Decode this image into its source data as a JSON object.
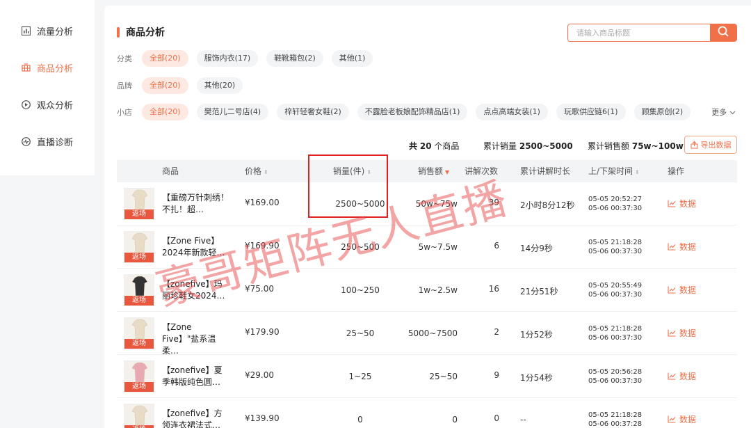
{
  "sidebar": {
    "items": [
      {
        "label": "流量分析",
        "icon": "bar-chart-icon",
        "active": false
      },
      {
        "label": "商品分析",
        "icon": "product-icon",
        "active": true
      },
      {
        "label": "观众分析",
        "icon": "play-circle-icon",
        "active": false
      },
      {
        "label": "直播诊断",
        "icon": "diagnosis-icon",
        "active": false
      }
    ]
  },
  "main": {
    "title": "商品分析",
    "search": {
      "placeholder": "请输入商品标题",
      "value": ""
    },
    "filters": {
      "category": {
        "label": "分类",
        "chips": [
          "全部(20)",
          "服饰内衣(17)",
          "鞋靴箱包(2)",
          "其他(1)"
        ],
        "active_index": 0
      },
      "brand": {
        "label": "品牌",
        "chips": [
          "全部(20)",
          "其他(20)"
        ],
        "active_index": 0
      },
      "shop": {
        "label": "小店",
        "chips": [
          "全部(20)",
          "樊范儿二号店(4)",
          "梓轩轻奢女鞋(2)",
          "不露脸老板娘配饰精品店(1)",
          "点点高端女装(1)",
          "玩歌供应链6(1)",
          "顾集原创(2)"
        ],
        "active_index": 0,
        "more_label": "更多"
      }
    },
    "summary": {
      "count_prefix": "共",
      "count_value": "20",
      "count_suffix": "个商品",
      "sales_label": "累计销量",
      "sales_value": "2500~5000",
      "revenue_label": "累计销售额",
      "revenue_value": "75w~100w"
    },
    "export_label": "导出数据",
    "table": {
      "headers": {
        "product": "商品",
        "price": "价格",
        "sales": "销量(件)",
        "revenue": "销售额",
        "explain_count": "讲解次数",
        "explain_duration": "累计讲解时长",
        "shelf_time": "上/下架时间",
        "action": "操作"
      },
      "badge_label": "返场",
      "action_label": "数据",
      "rows": [
        {
          "name": "【重磅万针刺绣！不扎！超…",
          "price": "¥169.00",
          "sales": "2500~5000",
          "revenue": "50w~75w",
          "explain_count": "39",
          "explain_duration": "2小时8分12秒",
          "up_time": "05-05   20:52:27",
          "down_time": "05-06   00:37:30"
        },
        {
          "name": "【Zone Five】2024年新款轻…",
          "price": "¥169.90",
          "sales": "250~500",
          "revenue": "5w~7.5w",
          "explain_count": "6",
          "explain_duration": "14分9秒",
          "up_time": "05-05   21:18:28",
          "down_time": "05-06   00:37:30"
        },
        {
          "name": "【zonefive】玛丽珍鞋女2024…",
          "price": "¥75.00",
          "sales": "100~250",
          "revenue": "1w~2.5w",
          "explain_count": "16",
          "explain_duration": "21分51秒",
          "up_time": "05-05   20:55:49",
          "down_time": "05-06   00:37:30"
        },
        {
          "name": "【Zone Five】\"盐系温柔…",
          "price": "¥179.90",
          "sales": "25~50",
          "revenue": "5000~7500",
          "explain_count": "2",
          "explain_duration": "1分52秒",
          "up_time": "05-05   21:18:28",
          "down_time": "05-06   00:37:30"
        },
        {
          "name": "【zonefive】夏季韩版纯色圆…",
          "price": "¥29.00",
          "sales": "1~25",
          "revenue": "25~50",
          "explain_count": "9",
          "explain_duration": "1分54秒",
          "up_time": "05-05   20:56:28",
          "down_time": "05-06   00:37:30"
        },
        {
          "name": "【zonefive】方领连衣裙法式…",
          "price": "¥139.90",
          "sales": "0",
          "revenue": "0",
          "explain_count": "0",
          "explain_duration": "--",
          "up_time": "05-05   21:18:28",
          "down_time": "05-06   00:37:28"
        }
      ]
    }
  },
  "watermark": "豪哥矩阵无人直播",
  "colors": {
    "accent": "#f0704a",
    "highlight": "#e02020",
    "watermark": "#e74c4c"
  }
}
